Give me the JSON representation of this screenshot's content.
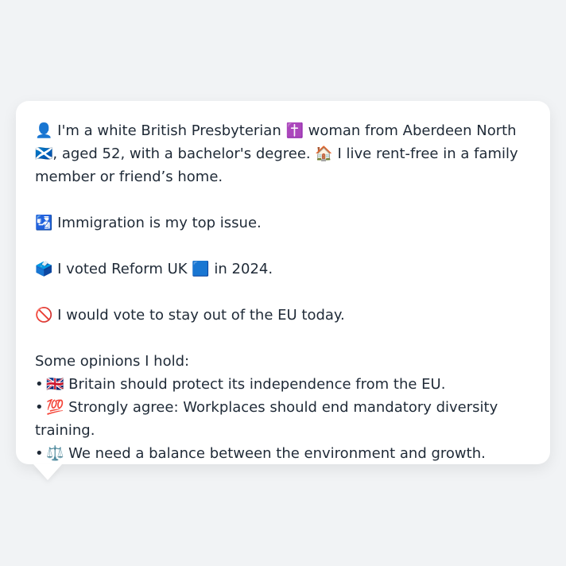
{
  "bio": {
    "line": "👤 I'm a white British Presbyterian ✝️ woman from Aberdeen North 🏴󠁧󠁢󠁳󠁣󠁴󠁿, aged 52, with a bachelor's degree. 🏠 I live rent-free in a family member or friend’s home."
  },
  "issue": {
    "line": "🛂 Immigration is my top issue."
  },
  "vote2024": {
    "line": "🗳️ I voted Reform UK 🟦 in 2024."
  },
  "eu": {
    "line": "🚫 I would vote to stay out of the EU today."
  },
  "opinions": {
    "heading": "Some opinions I hold:",
    "bullet": "•",
    "items": [
      "🇬🇧 Britain should protect its independence from the EU.",
      "💯 Strongly agree: Workplaces should end mandatory diversity training.",
      "⚖️ We need a balance between the environment and growth."
    ]
  }
}
